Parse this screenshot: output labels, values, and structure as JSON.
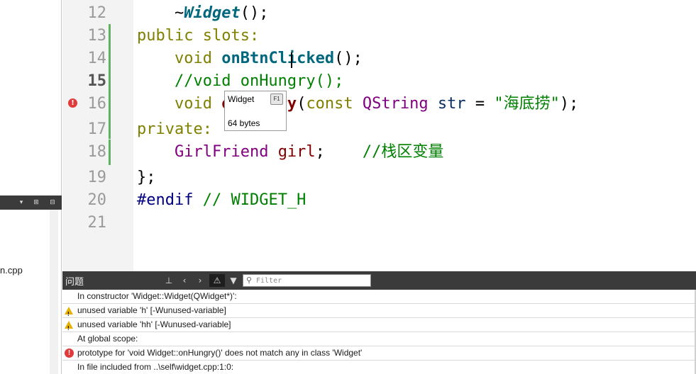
{
  "sidebar": {
    "file_name": "n.cpp",
    "toolbar_icons": [
      "dropdown-arrow-icon",
      "split-add-icon",
      "collapse-icon"
    ]
  },
  "editor": {
    "line_numbers": [
      "12",
      "13",
      "14",
      "15",
      "16",
      "17",
      "18",
      "19",
      "20",
      "21"
    ],
    "current_line": "15",
    "code": {
      "l12_tilde": "~",
      "l12_fn": "Widget",
      "l12_end": "();",
      "l13": "public slots:",
      "l14_kw": "void",
      "l14_fn": "onBtnClicked",
      "l14_end": "();",
      "l15": "//void onHungry();",
      "l16_kw": "void",
      "l16_fn": "onHungry",
      "l16_open": "(",
      "l16_const": "const",
      "l16_type": "QString",
      "l16_var": "str",
      "l16_eq": " = ",
      "l16_str": "\"海底捞\"",
      "l16_end": ");",
      "l17": "private:",
      "l18_type": "GirlFriend",
      "l18_var": "girl",
      "l18_semi": ";",
      "l18_comment": "//栈区变量",
      "l19": "};",
      "l20_pp": "#endif",
      "l20_comment": "// WIDGET_H"
    }
  },
  "tooltip": {
    "title": "Widget",
    "key": "F1",
    "size": "64 bytes"
  },
  "issues": {
    "title": "问题",
    "filter_placeholder": "Filter",
    "rows": [
      {
        "type": "info",
        "text": "In constructor 'Widget::Widget(QWidget*)':"
      },
      {
        "type": "warning",
        "text": "unused variable 'h' [-Wunused-variable]"
      },
      {
        "type": "warning",
        "text": "unused variable 'hh' [-Wunused-variable]"
      },
      {
        "type": "info",
        "text": "At global scope:"
      },
      {
        "type": "error",
        "text": "prototype for 'void Widget::onHungry()' does not match any in class 'Widget'"
      },
      {
        "type": "info",
        "text": "In file included from ..\\self\\widget.cpp:1:0:"
      }
    ]
  },
  "colors": {
    "keyword": "#808000",
    "function": "#00677c",
    "type": "#800080",
    "comment": "#008000",
    "error": "#e03a3a",
    "warning": "#e8b000"
  }
}
